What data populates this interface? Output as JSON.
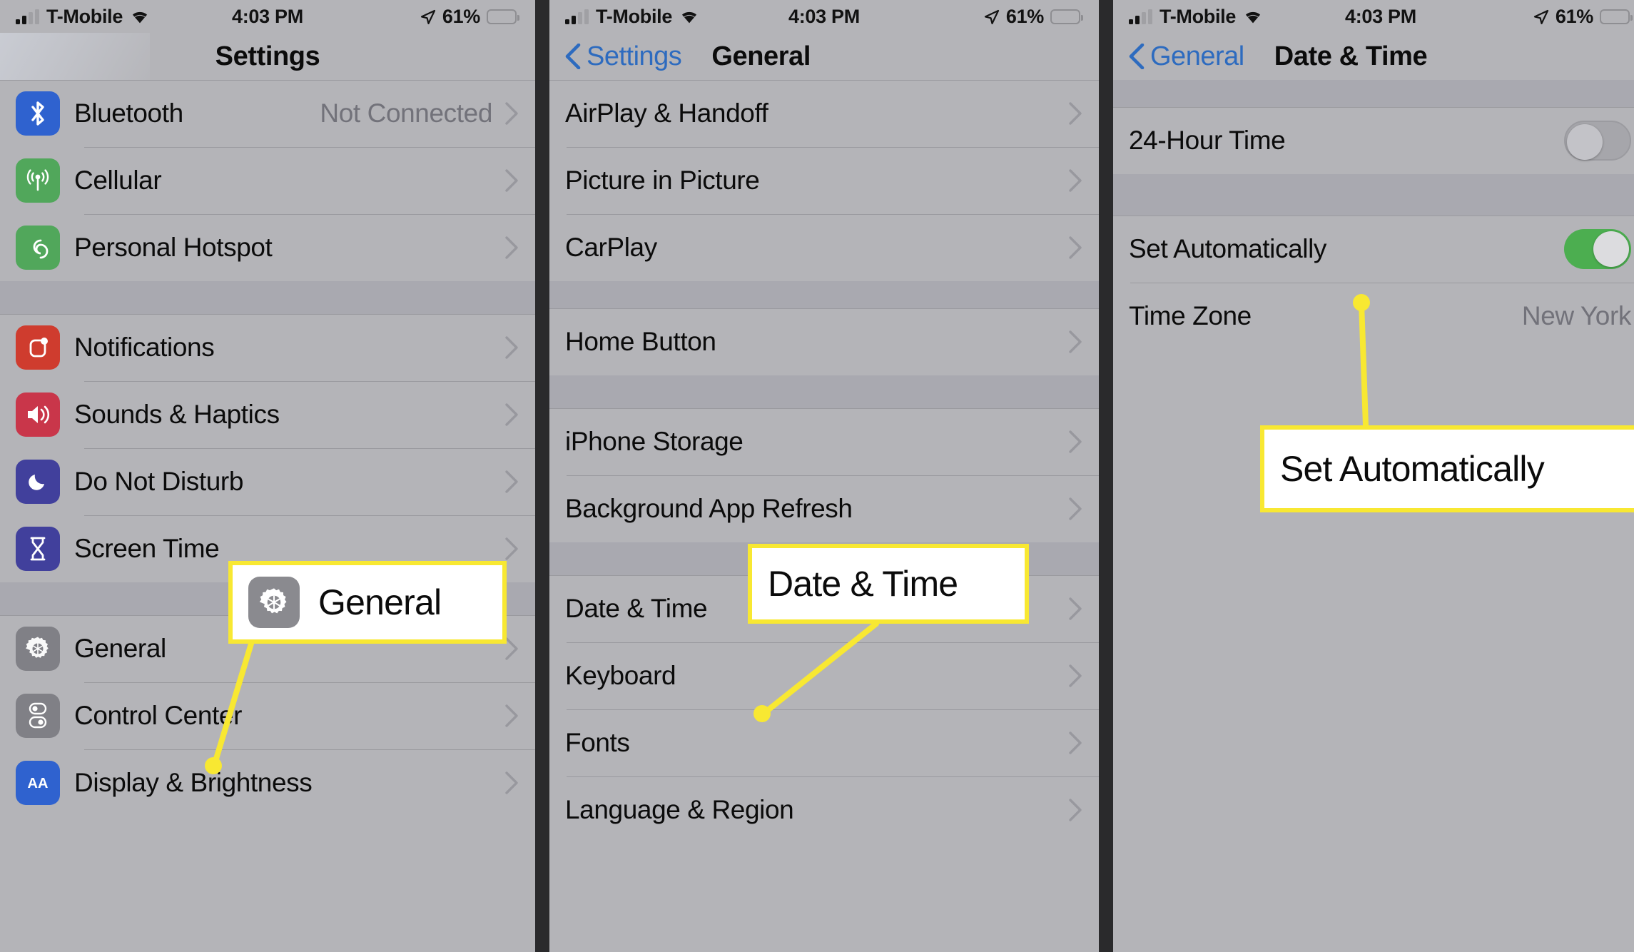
{
  "statusbar": {
    "carrier": "T-Mobile",
    "time": "4:03 PM",
    "battery_pct": "61%",
    "icons": {
      "signal": "signal-bars-icon",
      "wifi": "wifi-icon",
      "location": "location-arrow-icon",
      "battery": "battery-icon"
    }
  },
  "colors": {
    "screen_bg": "#b4b4b8",
    "group_gap": "#a9a9b0",
    "separator": "#9a9a9f",
    "tint_blue": "#2d6bbf",
    "callout_border": "#f8e832",
    "leader_line": "#f8e832",
    "toggle_on": "#4cae50",
    "toggle_off": "#a6a6ab",
    "frame": "#2a2a2c",
    "secondary_text": "#72727a"
  },
  "panels": [
    {
      "id": "settings",
      "nav": {
        "title": "Settings",
        "back": null
      },
      "groups": [
        {
          "id": "connectivity",
          "rows": [
            {
              "label": "Bluetooth",
              "value": "Not Connected",
              "icon": "bluetooth-icon",
              "icon_color": "#2f62cf",
              "chevron": true
            },
            {
              "label": "Cellular",
              "value": "",
              "icon": "cellular-icon",
              "icon_color": "#51a75b",
              "chevron": true
            },
            {
              "label": "Personal Hotspot",
              "value": "",
              "icon": "personal-hotspot-icon",
              "icon_color": "#51a75b",
              "chevron": true
            }
          ]
        },
        {
          "id": "alerts",
          "rows": [
            {
              "label": "Notifications",
              "value": "",
              "icon": "notifications-icon",
              "icon_color": "#cf3c2e",
              "chevron": true
            },
            {
              "label": "Sounds & Haptics",
              "value": "",
              "icon": "sounds-haptics-icon",
              "icon_color": "#c9364a",
              "chevron": true
            },
            {
              "label": "Do Not Disturb",
              "value": "",
              "icon": "do-not-disturb-icon",
              "icon_color": "#41409c",
              "chevron": true
            },
            {
              "label": "Screen Time",
              "value": "",
              "icon": "screen-time-icon",
              "icon_color": "#41409c",
              "chevron": true
            }
          ]
        },
        {
          "id": "system",
          "rows": [
            {
              "label": "General",
              "value": "",
              "icon": "gear-icon",
              "icon_color": "#808086",
              "chevron": true
            },
            {
              "label": "Control Center",
              "value": "",
              "icon": "control-center-icon",
              "icon_color": "#808086",
              "chevron": true
            },
            {
              "label": "Display & Brightness",
              "value": "",
              "icon": "display-brightness-icon",
              "icon_color": "#2f62cf",
              "chevron": true
            }
          ]
        }
      ]
    },
    {
      "id": "general",
      "nav": {
        "title": "General",
        "back": "Settings"
      },
      "groups": [
        {
          "id": "airplay-group",
          "rows": [
            {
              "label": "AirPlay & Handoff",
              "value": "",
              "icon": null,
              "chevron": true
            },
            {
              "label": "Picture in Picture",
              "value": "",
              "icon": null,
              "chevron": true
            },
            {
              "label": "CarPlay",
              "value": "",
              "icon": null,
              "chevron": true
            }
          ]
        },
        {
          "id": "home-button-group",
          "rows": [
            {
              "label": "Home Button",
              "value": "",
              "icon": null,
              "chevron": true
            }
          ]
        },
        {
          "id": "storage-group",
          "rows": [
            {
              "label": "iPhone Storage",
              "value": "",
              "icon": null,
              "chevron": true
            },
            {
              "label": "Background App Refresh",
              "value": "",
              "icon": null,
              "chevron": true
            }
          ]
        },
        {
          "id": "locale-group",
          "rows": [
            {
              "label": "Date & Time",
              "value": "",
              "icon": null,
              "chevron": true
            },
            {
              "label": "Keyboard",
              "value": "",
              "icon": null,
              "chevron": true
            },
            {
              "label": "Fonts",
              "value": "",
              "icon": null,
              "chevron": true
            },
            {
              "label": "Language & Region",
              "value": "",
              "icon": null,
              "chevron": true
            }
          ]
        }
      ]
    },
    {
      "id": "date-time",
      "nav": {
        "title": "Date & Time",
        "back": "General"
      },
      "groups": [
        {
          "id": "format-group",
          "rows": [
            {
              "label": "24-Hour Time",
              "value": "",
              "icon": null,
              "chevron": false,
              "toggle": "off"
            }
          ]
        },
        {
          "id": "auto-group",
          "rows": [
            {
              "label": "Set Automatically",
              "value": "",
              "icon": null,
              "chevron": false,
              "toggle": "on"
            },
            {
              "label": "Time Zone",
              "value": "New York",
              "icon": null,
              "chevron": false
            }
          ]
        }
      ]
    }
  ],
  "callouts": [
    {
      "id": "general-callout",
      "text": "General",
      "has_gear_icon": true
    },
    {
      "id": "date-time-callout",
      "text": "Date & Time",
      "has_gear_icon": false
    },
    {
      "id": "set-automatically-callout",
      "text": "Set Automatically",
      "has_gear_icon": false
    }
  ]
}
